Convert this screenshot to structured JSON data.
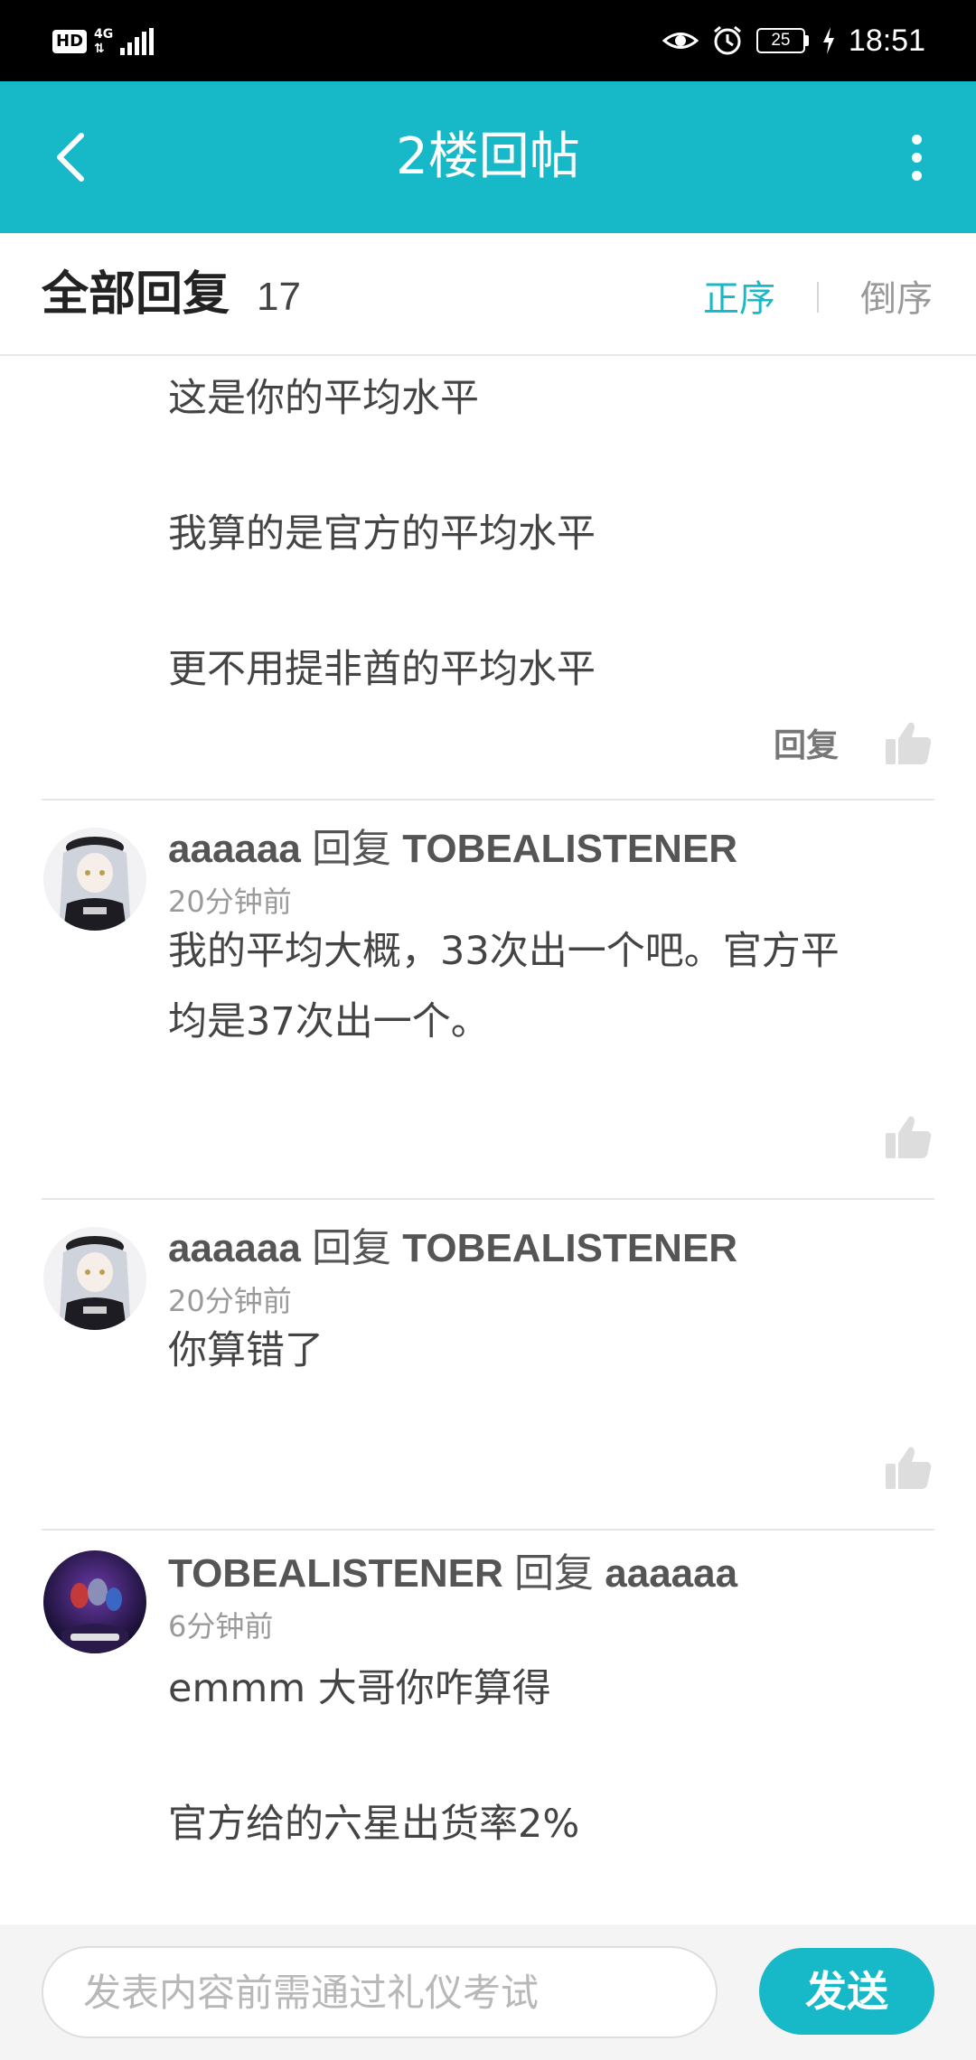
{
  "status_bar": {
    "hd": "HD",
    "network": "4G",
    "battery": "25",
    "time": "18:51"
  },
  "header": {
    "title": "2楼回帖",
    "back_icon": "chevron-left-icon",
    "menu_icon": "more-vertical-icon"
  },
  "replies_header": {
    "title": "全部回复",
    "count": "17",
    "sort_asc": "正序",
    "sort_desc": "倒序"
  },
  "continued_reply": {
    "lines": [
      "这是你的平均水平",
      "我算的是官方的平均水平",
      "更不用提非酋的平均水平"
    ],
    "reply_label": "回复"
  },
  "replies": [
    {
      "author": "aaaaaa",
      "reply_word": "回复",
      "target": "TOBEALISTENER",
      "time": "20分钟前",
      "lines": [
        "我的平均大概，33次出一个吧。官方平",
        "均是37次出一个。"
      ]
    },
    {
      "author": "aaaaaa",
      "reply_word": "回复",
      "target": "TOBEALISTENER",
      "time": "20分钟前",
      "lines": [
        "你算错了"
      ]
    },
    {
      "author": "TOBEALISTENER",
      "reply_word": "回复",
      "target": "aaaaaa",
      "time": "6分钟前",
      "lines": [
        "emmm 大哥你咋算得",
        "官方给的六星出货率2%"
      ]
    }
  ],
  "input_bar": {
    "placeholder": "发表内容前需通过礼仪考试",
    "send_label": "发送"
  },
  "colors": {
    "accent": "#17b8c8",
    "status_bar": "#000000"
  }
}
